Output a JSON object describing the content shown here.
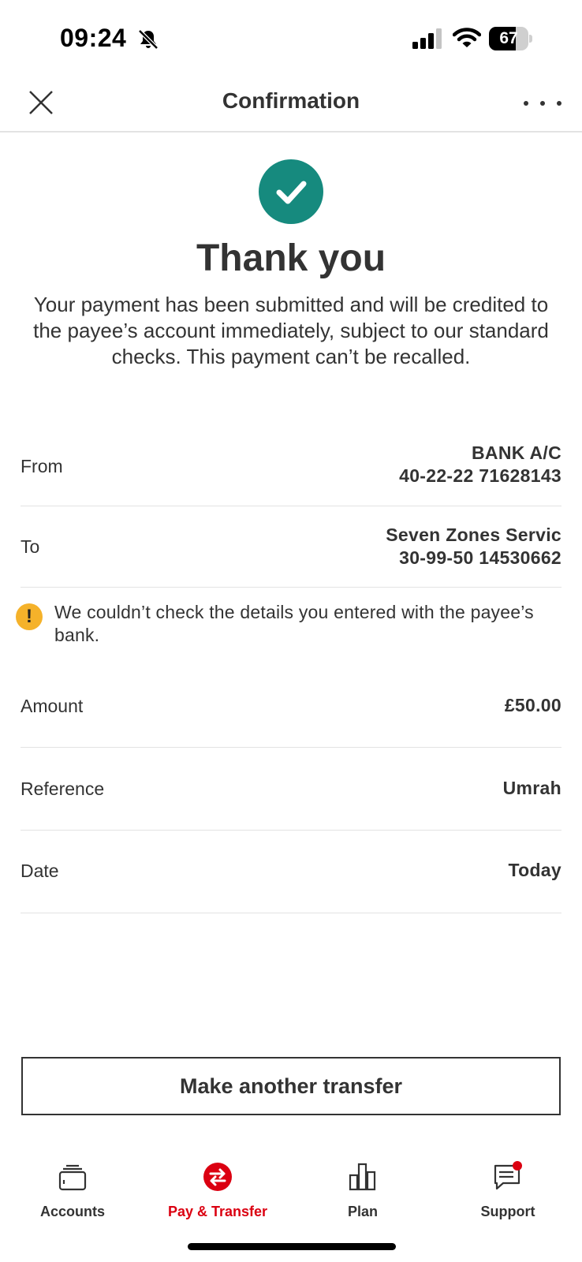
{
  "status_bar": {
    "time": "09:24",
    "battery_level": "67",
    "battery_fraction": 0.67,
    "icons": [
      "bell-slash-icon",
      "signal-icon",
      "wifi-icon",
      "battery-icon"
    ]
  },
  "header": {
    "title": "Confirmation",
    "close_icon": "close-icon",
    "more_icon": "more-options-icon"
  },
  "success": {
    "icon": "checkmark-circle-icon",
    "title": "Thank you",
    "message": "Your payment has been submitted and will be credited to the payee’s account immediately, subject to our standard checks. This payment can’t be recalled."
  },
  "details": {
    "from": {
      "label": "From",
      "line1": "BANK A/C",
      "line2": "40-22-22 71628143"
    },
    "to": {
      "label": "To",
      "line1": "Seven Zones Servic",
      "line2": "30-99-50 14530662"
    },
    "warning": {
      "icon": "warning-icon",
      "text": "We couldn’t check the details you entered with the payee’s bank."
    },
    "amount": {
      "label": "Amount",
      "value": "£50.00"
    },
    "reference": {
      "label": "Reference",
      "value": "Umrah"
    },
    "date": {
      "label": "Date",
      "value": "Today"
    }
  },
  "actions": {
    "make_another_transfer": "Make another transfer"
  },
  "nav": {
    "active_color": "#db0011",
    "items": [
      {
        "label": "Accounts",
        "icon": "accounts-icon"
      },
      {
        "label": "Pay & Transfer",
        "icon": "pay-transfer-icon"
      },
      {
        "label": "Plan",
        "icon": "plan-icon"
      },
      {
        "label": "Support",
        "icon": "support-icon"
      }
    ]
  },
  "colors": {
    "success": "#168a7e",
    "warning": "#f5b22a",
    "brand_red": "#db0011",
    "text": "#333333"
  }
}
